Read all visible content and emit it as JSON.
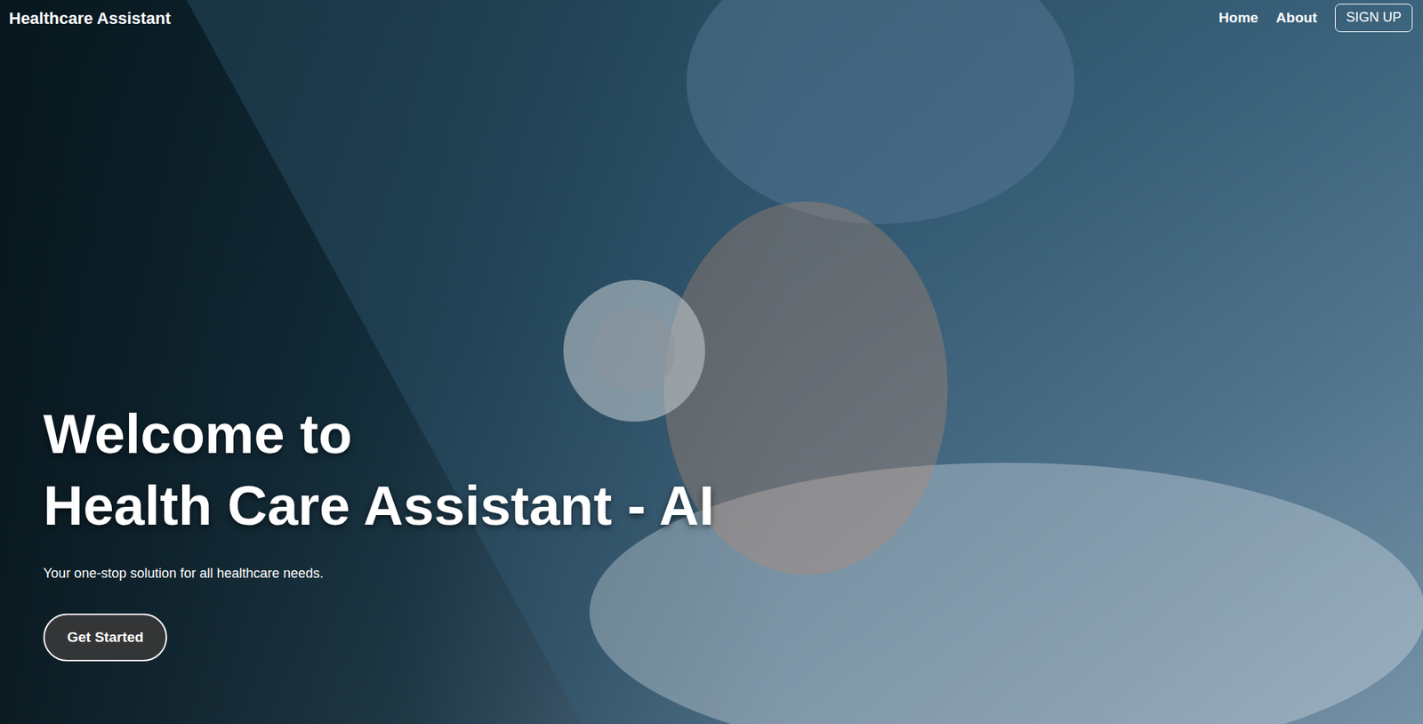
{
  "navbar": {
    "brand": "Healthcare Assistant",
    "links": [
      "Home",
      "About"
    ],
    "signup": "SIGN UP"
  },
  "hero": {
    "title": [
      "Welcome to",
      "Health Care Assistant - AI"
    ],
    "subtitle": "Your one-stop solution for all healthcare needs.",
    "button": "Get Started"
  }
}
